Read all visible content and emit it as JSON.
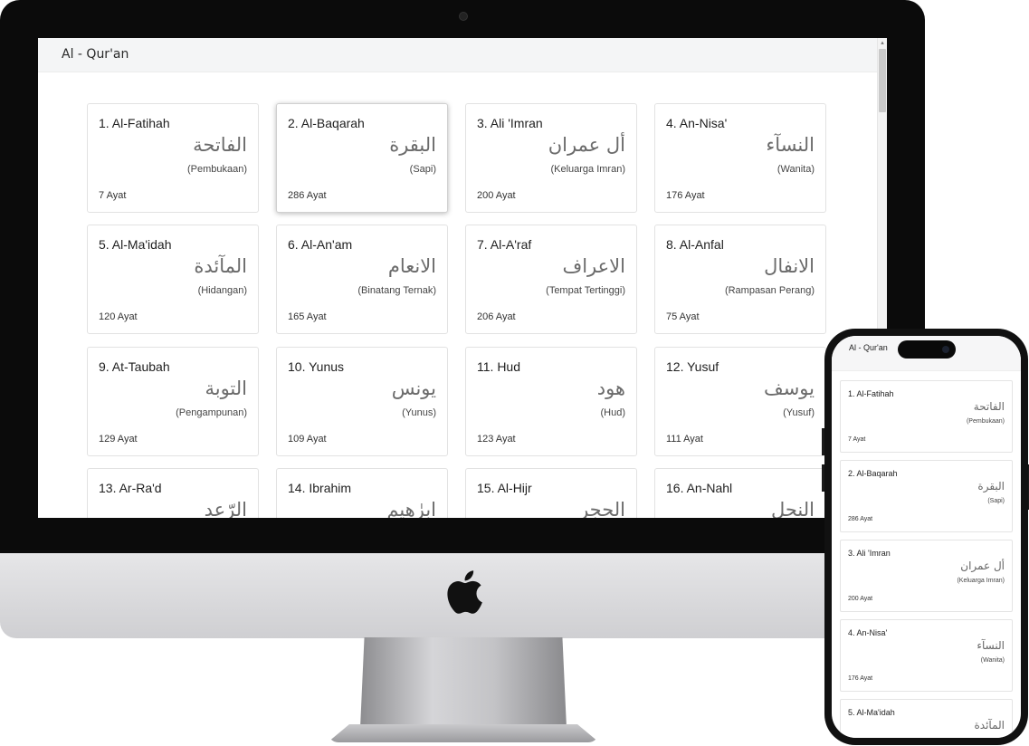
{
  "app": {
    "title": "Al - Qur'an"
  },
  "surahs": [
    {
      "name": "1. Al-Fatihah",
      "arabic": "الفاتحة",
      "meaning": "(Pembukaan)",
      "ayat": "7 Ayat"
    },
    {
      "name": "2. Al-Baqarah",
      "arabic": "البقرة",
      "meaning": "(Sapi)",
      "ayat": "286 Ayat"
    },
    {
      "name": "3. Ali 'Imran",
      "arabic": "أل عمران",
      "meaning": "(Keluarga Imran)",
      "ayat": "200 Ayat"
    },
    {
      "name": "4. An-Nisa'",
      "arabic": "النسآء",
      "meaning": "(Wanita)",
      "ayat": "176 Ayat"
    },
    {
      "name": "5. Al-Ma'idah",
      "arabic": "المآئدة",
      "meaning": "(Hidangan)",
      "ayat": "120 Ayat"
    },
    {
      "name": "6. Al-An'am",
      "arabic": "الانعام",
      "meaning": "(Binatang Ternak)",
      "ayat": "165 Ayat"
    },
    {
      "name": "7. Al-A'raf",
      "arabic": "الاعراف",
      "meaning": "(Tempat Tertinggi)",
      "ayat": "206 Ayat"
    },
    {
      "name": "8. Al-Anfal",
      "arabic": "الانفال",
      "meaning": "(Rampasan Perang)",
      "ayat": "75 Ayat"
    },
    {
      "name": "9. At-Taubah",
      "arabic": "التوبة",
      "meaning": "(Pengampunan)",
      "ayat": "129 Ayat"
    },
    {
      "name": "10. Yunus",
      "arabic": "يونس",
      "meaning": "(Yunus)",
      "ayat": "109 Ayat"
    },
    {
      "name": "11. Hud",
      "arabic": "هود",
      "meaning": "(Hud)",
      "ayat": "123 Ayat"
    },
    {
      "name": "12. Yusuf",
      "arabic": "يوسف",
      "meaning": "(Yusuf)",
      "ayat": "111 Ayat"
    },
    {
      "name": "13. Ar-Ra'd",
      "arabic": "الرّعد",
      "meaning": "",
      "ayat": ""
    },
    {
      "name": "14. Ibrahim",
      "arabic": "ابرٰهيم",
      "meaning": "",
      "ayat": ""
    },
    {
      "name": "15. Al-Hijr",
      "arabic": "الحجر",
      "meaning": "",
      "ayat": ""
    },
    {
      "name": "16. An-Nahl",
      "arabic": "النحل",
      "meaning": "",
      "ayat": ""
    }
  ],
  "phone": {
    "title": "Al - Qur'an",
    "surahs": [
      {
        "name": "1. Al-Fatihah",
        "arabic": "الفاتحة",
        "meaning": "(Pembukaan)",
        "ayat": "7 Ayat"
      },
      {
        "name": "2. Al-Baqarah",
        "arabic": "البقرة",
        "meaning": "(Sapi)",
        "ayat": "286 Ayat"
      },
      {
        "name": "3. Ali 'Imran",
        "arabic": "أل عمران",
        "meaning": "(Keluarga Imran)",
        "ayat": "200 Ayat"
      },
      {
        "name": "4. An-Nisa'",
        "arabic": "النسآء",
        "meaning": "(Wanita)",
        "ayat": "176 Ayat"
      },
      {
        "name": "5. Al-Ma'idah",
        "arabic": "المآئدة",
        "meaning": "",
        "ayat": ""
      }
    ]
  },
  "icons": {
    "scroll_up": "▴",
    "apple": "apple-logo"
  },
  "colors": {
    "card_border": "#e2e2e2",
    "header_bg": "#f4f5f6",
    "bezel": "#0b0b0b"
  }
}
